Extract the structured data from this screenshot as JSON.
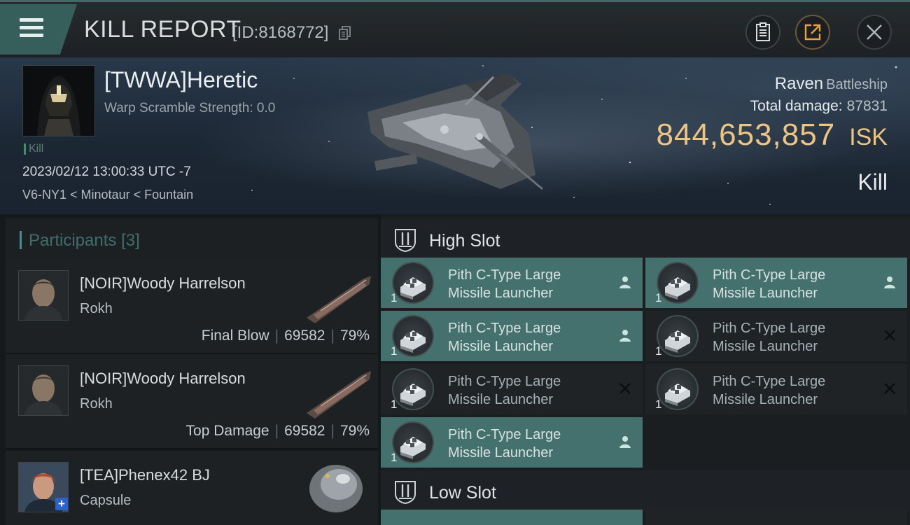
{
  "header": {
    "title": "KILL REPORT",
    "report_id": "[ID:8168772]"
  },
  "victim": {
    "name": "[TWWA]Heretic",
    "warp_scramble": "Warp Scramble Strength: 0.0",
    "tag": "Kill",
    "datetime": "2023/02/12 13:00:33 UTC -7",
    "location": "V6-NY1 < Minotaur < Fountain",
    "ship_name": "Raven",
    "ship_class": "Battleship",
    "total_damage_label": "Total damage:",
    "total_damage": "87831",
    "isk_value": "844,653,857",
    "isk_unit": "ISK",
    "result": "Kill"
  },
  "participants": {
    "label": "Participants",
    "count": "[3]",
    "items": [
      {
        "name": "[NOIR]Woody Harrelson",
        "ship": "Rokh",
        "role": "Final Blow",
        "damage": "69582",
        "percent": "79%"
      },
      {
        "name": "[NOIR]Woody Harrelson",
        "ship": "Rokh",
        "role": "Top Damage",
        "damage": "69582",
        "percent": "79%"
      },
      {
        "name": "[TEA]Phenex42 BJ",
        "ship": "Capsule"
      }
    ]
  },
  "fittings": {
    "high_slot_label": "High Slot",
    "low_slot_label": "Low Slot",
    "modules": [
      {
        "line1": "Pith C-Type Large",
        "line2": "Missile Launcher",
        "qty": "1",
        "status": "dropped"
      },
      {
        "line1": "Pith C-Type Large",
        "line2": "Missile Launcher",
        "qty": "1",
        "status": "dropped"
      },
      {
        "line1": "Pith C-Type Large",
        "line2": "Missile Launcher",
        "qty": "1",
        "status": "dropped"
      },
      {
        "line1": "Pith C-Type Large",
        "line2": "Missile Launcher",
        "qty": "1",
        "status": "destroyed"
      },
      {
        "line1": "Pith C-Type Large",
        "line2": "Missile Launcher",
        "qty": "1",
        "status": "destroyed"
      },
      {
        "line1": "Pith C-Type Large",
        "line2": "Missile Launcher",
        "qty": "1",
        "status": "destroyed"
      },
      {
        "line1": "Pith C-Type Large",
        "line2": "Missile Launcher",
        "qty": "1",
        "status": "dropped"
      }
    ]
  },
  "colors": {
    "accent_teal": "#44716d",
    "isk_gold": "#ecc584",
    "menu_teal": "#365f5c"
  }
}
